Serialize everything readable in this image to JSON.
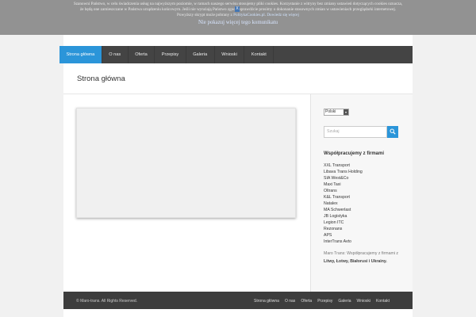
{
  "cookie": {
    "line1": "Szanowni Państwo, w celu świadczenia usług na najwyższym poziomie, w ramach naszego serwisu stosujemy pliki cookies. Korzystanie z witryny bez zmiany ustawień dotyczących cookies oznacza,",
    "line2": "że będą one zamieszczane w Państwa urządzeniu końcowym. Jeśli nie wyrażają Państwo zgody, sprawdźcie prosimy o dokonanie stosownych zmian w ustawieniach przeglądarki internetowej.",
    "line3_text": "Powyższy skrypt może pobrany z",
    "line3_link1": "PolitykaCookies.pl",
    "line3_link2": "Dowiedz się więcej",
    "dismiss": "Nie pokazuj więcej tego komunikatu",
    "close_glyph": "X"
  },
  "nav": {
    "items": [
      "Strona główna",
      "O nas",
      "Oferta",
      "Przepisy",
      "Galeria",
      "Wnioski",
      "Kontakt"
    ]
  },
  "page_title": "Strona główna",
  "sidebar": {
    "language": "Polski",
    "language_arrow": "▾",
    "search_placeholder": "Szukaj",
    "partners_title": "Współpracujemy z firmami",
    "partners": [
      "XXL Transport",
      "Libava Trans Holding",
      "SIA West&Co",
      "Maxi Taxi",
      "Oltrans",
      "K&L Transport",
      "Natalex",
      "MA Schwerlast",
      "JB Logistyka",
      "Legion ITC",
      "Rezonans",
      "APS",
      "InterTrans Avto"
    ],
    "note_prefix": "Maro Trans: Współpracujemy z firmami z",
    "note_countries": "Litwy, Łotwy, Białorusi i Ukrainy."
  },
  "footer": {
    "copyright": "© Maro-trans. All Rights Reserved.",
    "links": [
      "Strona główna",
      "O nas",
      "Oferta",
      "Przepisy",
      "Galeria",
      "Wnioski",
      "Kontakt"
    ]
  },
  "colors": {
    "accent": "#2b95d9",
    "nav_bg": "#444444",
    "footer_bg": "#3d3d3d"
  }
}
